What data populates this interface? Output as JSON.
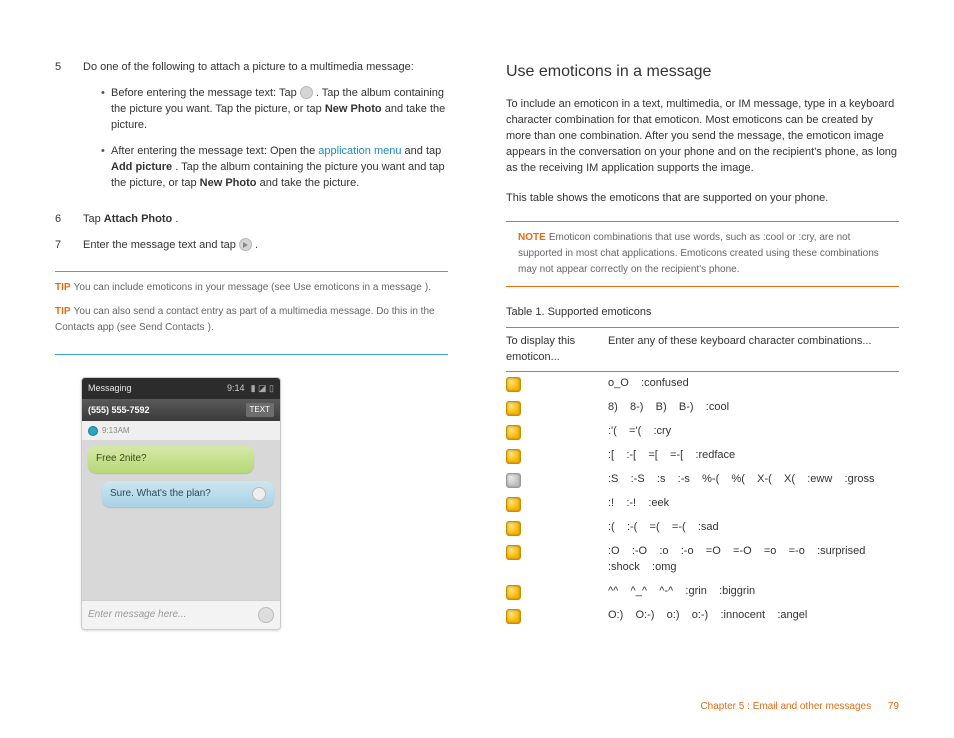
{
  "left": {
    "steps": [
      {
        "num": "5",
        "lead": "Do one of the following to attach a picture to a multimedia message:",
        "subs": [
          {
            "pre": "Before entering the message text: Tap ",
            "post": ". Tap the album containing the picture you want. Tap the picture, or tap ",
            "bold": "New Photo",
            "tail": " and take the picture."
          },
          {
            "pre": "After entering the message text: Open the ",
            "link": "application menu",
            "mid": " and tap ",
            "bold1": "Add picture",
            "mid2": ". Tap the album containing the picture you want and tap the picture, or tap ",
            "bold2": "New Photo",
            "tail": " and take the picture."
          }
        ]
      },
      {
        "num": "6",
        "pre": "Tap ",
        "bold": "Attach Photo",
        "tail": "."
      },
      {
        "num": "7",
        "pre": "Enter the message text and tap ",
        "icon": true,
        "tail": "."
      }
    ],
    "tips": [
      {
        "label": "TIP",
        "pre": " You can include emoticons in your message (see ",
        "link": "Use emoticons in a message",
        "tail": ")."
      },
      {
        "label": "TIP",
        "pre": " You can also send a contact entry as part of a multimedia message. Do this in the Contacts app (see ",
        "link": "Send Contacts",
        "tail": ")."
      }
    ],
    "phone": {
      "topTitle": "Messaging",
      "topTime": "9:14",
      "sigIcons": "▮ ◪ ▯",
      "barNum": "(555) 555-7592",
      "barBadge": "TEXT",
      "threadTime": "9:13AM",
      "msg1": "Free 2nite?",
      "msg2": "Sure. What's the plan?",
      "placeholder": "Enter message here..."
    }
  },
  "right": {
    "heading": "Use emoticons in a message",
    "para1": "To include an emoticon in a text, multimedia, or IM message, type in a keyboard character combination for that emoticon. Most emoticons can be created by more than one combination. After you send the message, the emoticon image appears in the conversation on your phone and on the recipient's phone, as long as the receiving IM application supports the image.",
    "para2": "This table shows the emoticons that are supported on your phone.",
    "note": {
      "label": "NOTE",
      "text": " Emoticon combinations that use words, such as :cool or :cry, are not supported in most chat applications. Emoticons created using these combinations may not appear correctly on the recipient's phone."
    },
    "tableCaption": "Table 1.  Supported emoticons",
    "th1": "To display this emoticon...",
    "th2": "Enter any of these keyboard character combinations...",
    "rows": [
      {
        "grey": false,
        "combo": "o_O    :confused"
      },
      {
        "grey": false,
        "combo": "8)    8-)    B)    B-)    :cool"
      },
      {
        "grey": false,
        "combo": ":'(    ='(    :cry"
      },
      {
        "grey": false,
        "combo": ":[    :-[    =[    =-[    :redface"
      },
      {
        "grey": true,
        "combo": ":S    :-S    :s    :-s    %-(    %(    X-(    X(    :eww    :gross"
      },
      {
        "grey": false,
        "combo": ":!    :-!    :eek"
      },
      {
        "grey": false,
        "combo": ":(    :-(    =(    =-(    :sad"
      },
      {
        "grey": false,
        "combo": ":O    :-O    :o    :-o    =O    =-O    =o    =-o    :surprised    :shock    :omg"
      },
      {
        "grey": false,
        "combo": "^^    ^_^    ^-^    :grin    :biggrin"
      },
      {
        "grey": false,
        "combo": "O:)    O:-)    o:)    o:-)    :innocent    :angel"
      }
    ]
  },
  "footer": {
    "chapter": "Chapter 5  :  Email and other messages",
    "page": "79"
  }
}
